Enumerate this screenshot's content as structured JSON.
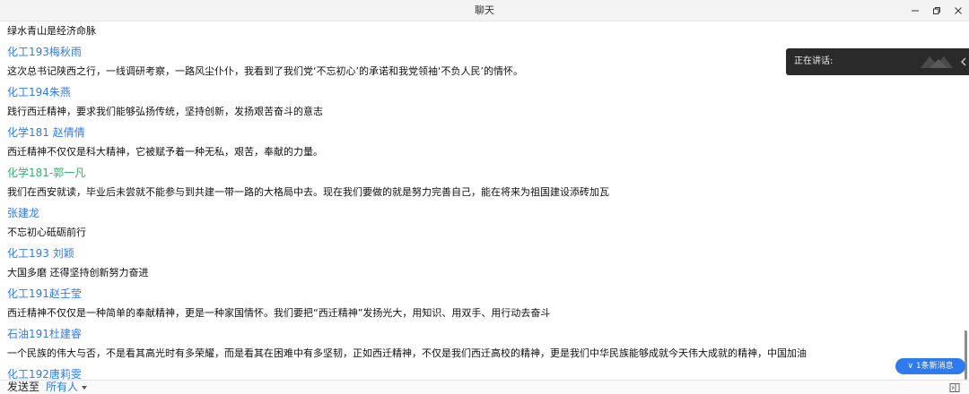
{
  "window": {
    "title": "聊天",
    "minimize_icon": "minimize-icon",
    "restore_icon": "restore-icon",
    "close_icon": "close-icon"
  },
  "speaking_panel": {
    "label": "正在讲话:"
  },
  "messages": [
    {
      "sender": "",
      "text": "绿水青山是经济命脉",
      "color": "#2e7bf0"
    },
    {
      "sender": "化工193梅秋雨",
      "text": "这次总书记陕西之行，一线调研考察，一路风尘仆仆，我看到了我们党‘不忘初心’的承诺和我党领袖‘不负人民’的情怀。",
      "color": "#2e7bf0"
    },
    {
      "sender": "化工194朱燕",
      "text": "践行西迁精神，要求我们能够弘扬传统，坚持创新，发扬艰苦奋斗的意志",
      "color": "#2e7bf0"
    },
    {
      "sender": "化学181 赵倩倩",
      "text": "西迁精神不仅仅是科大精神，它被赋予着一种无私，艰苦，奉献的力量。",
      "color": "#2e7bf0"
    },
    {
      "sender": "化学181-郭一凡",
      "text": "我们在西安就读，毕业后未尝就不能参与到共建一带一路的大格局中去。现在我们要做的就是努力完善自己，能在将来为祖国建设添砖加瓦",
      "color": "#2fb46b"
    },
    {
      "sender": "张建龙",
      "text": "不忘初心砥砺前行",
      "color": "#2e7bf0"
    },
    {
      "sender": "化工193 刘颖",
      "text": "大国多磨 还得坚持创新努力奋进",
      "color": "#2e7bf0"
    },
    {
      "sender": "化工191赵壬莹",
      "text": "西迁精神不仅仅是一种简单的奉献精神，更是一种家国情怀。我们要把“西迁精神”发扬光大，用知识、用双手、用行动去奋斗",
      "color": "#2e7bf0"
    },
    {
      "sender": "石油191杜建睿",
      "text": "一个民族的伟大与否，不是看其高光时有多荣耀，而是看其在困难中有多坚韧，正如西迁精神，不仅是我们西迁高校的精神，更是我们中华民族能够成就今天伟大成就的精神，中国加油",
      "color": "#2e7bf0"
    },
    {
      "sender": "化工192唐莉雯",
      "text": "",
      "color": "#2e7bf0"
    }
  ],
  "new_message_button": {
    "label": "∨ 1条新消息"
  },
  "bottom": {
    "send_to": "发送至",
    "target": "所有人"
  },
  "colors": {
    "accent": "#2e7bf0",
    "green_sender": "#2fb46b",
    "panel": "#2a2a2a"
  }
}
